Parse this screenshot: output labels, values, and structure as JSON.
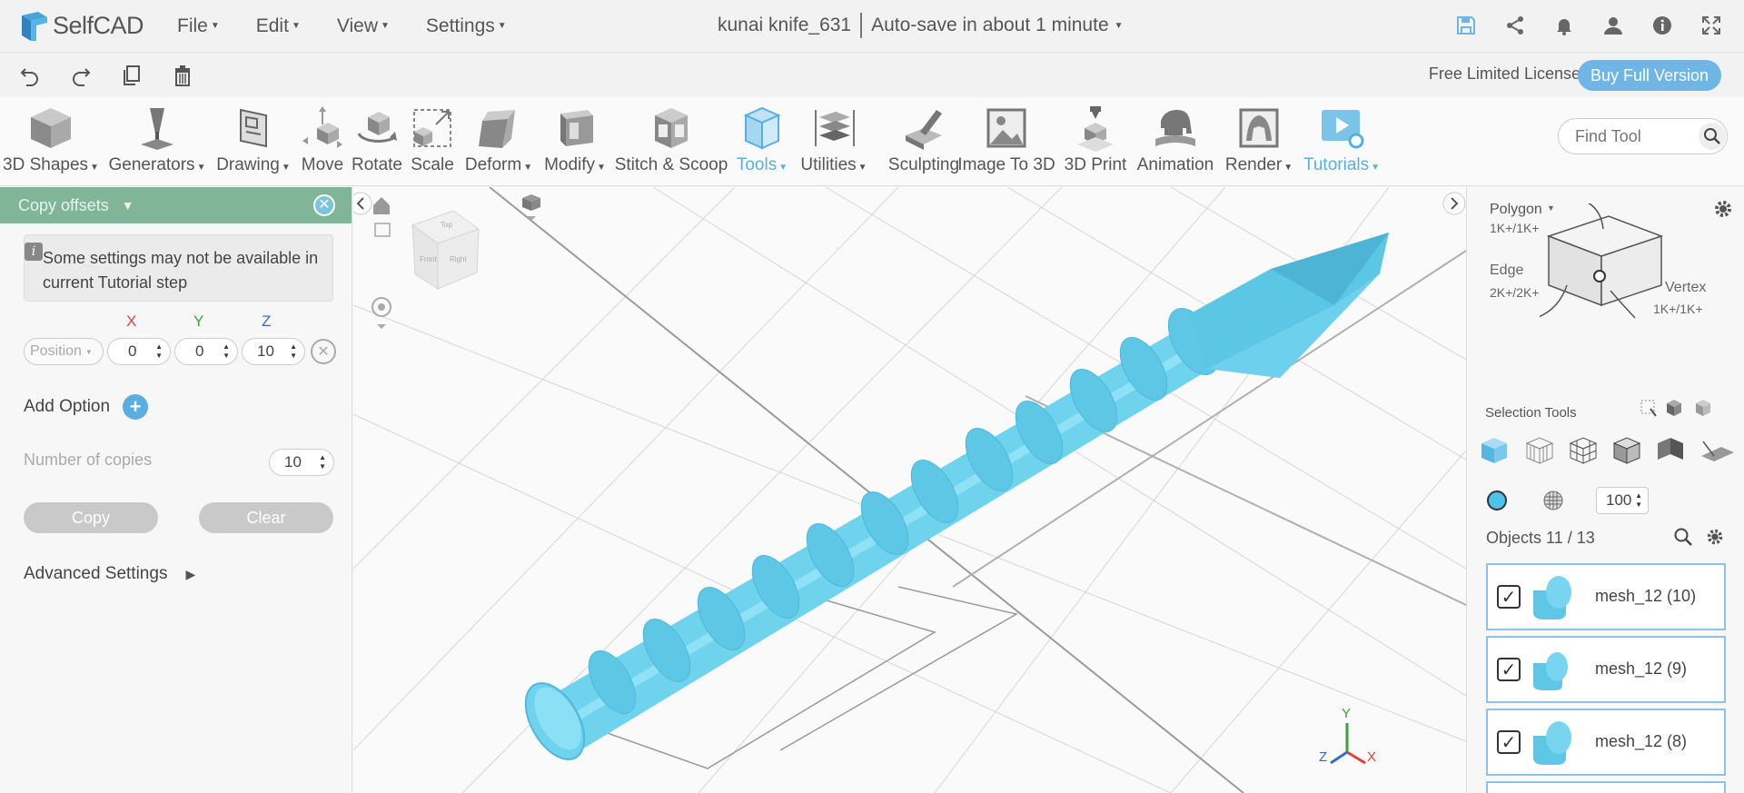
{
  "app": {
    "name": "SelfCAD"
  },
  "menus": [
    {
      "label": "File"
    },
    {
      "label": "Edit"
    },
    {
      "label": "View"
    },
    {
      "label": "Settings"
    }
  ],
  "document": {
    "title": "kunai knife_631",
    "autosave": "Auto-save in about 1 minute"
  },
  "license": {
    "text": "Free Limited License",
    "buy_label": "Buy Full Version"
  },
  "toolbar": {
    "tools": [
      {
        "label": "3D Shapes",
        "dropdown": true
      },
      {
        "label": "Generators",
        "dropdown": true
      },
      {
        "label": "Drawing",
        "dropdown": true
      },
      {
        "label": "Move"
      },
      {
        "label": "Rotate"
      },
      {
        "label": "Scale"
      },
      {
        "label": "Deform",
        "dropdown": true
      },
      {
        "label": "Modify",
        "dropdown": true
      },
      {
        "label": "Stitch & Scoop"
      },
      {
        "label": "Tools",
        "dropdown": true,
        "active": true
      },
      {
        "label": "Utilities",
        "dropdown": true
      },
      {
        "label": "Sculpting"
      },
      {
        "label": "Image To 3D"
      },
      {
        "label": "3D Print"
      },
      {
        "label": "Animation"
      },
      {
        "label": "Render",
        "dropdown": true
      },
      {
        "label": "Tutorials",
        "dropdown": true,
        "active": true
      }
    ],
    "find_placeholder": "Find Tool"
  },
  "left_panel": {
    "title": "Copy offsets",
    "info": "Some settings may not be available in current Tutorial step",
    "axes": {
      "x": "X",
      "y": "Y",
      "z": "Z"
    },
    "position_select": "Position",
    "x_value": "0",
    "y_value": "0",
    "z_value": "10",
    "add_option": "Add Option",
    "copies_label": "Number of copies",
    "copies_value": "10",
    "copy_btn": "Copy",
    "clear_btn": "Clear",
    "advanced": "Advanced Settings"
  },
  "viewport": {
    "cube_faces": {
      "top": "Top",
      "front": "Front",
      "right": "Right"
    },
    "axis_labels": {
      "x": "X",
      "y": "Y",
      "z": "Z"
    }
  },
  "right_panel": {
    "polygon_label": "Polygon",
    "polygon_count": "1K+/1K+",
    "edge_label": "Edge",
    "edge_count": "2K+/2K+",
    "vertex_label": "Vertex",
    "vertex_count": "1K+/1K+",
    "selection_tools": "Selection Tools",
    "opacity_value": "100",
    "objects_label": "Objects 11 / 13",
    "objects": [
      {
        "name": "mesh_12 (10)"
      },
      {
        "name": "mesh_12 (9)"
      },
      {
        "name": "mesh_12 (8)"
      }
    ]
  },
  "colors": {
    "accent": "#5aaee0",
    "panel_header": "#80b597",
    "model": "#6ed3ee"
  }
}
